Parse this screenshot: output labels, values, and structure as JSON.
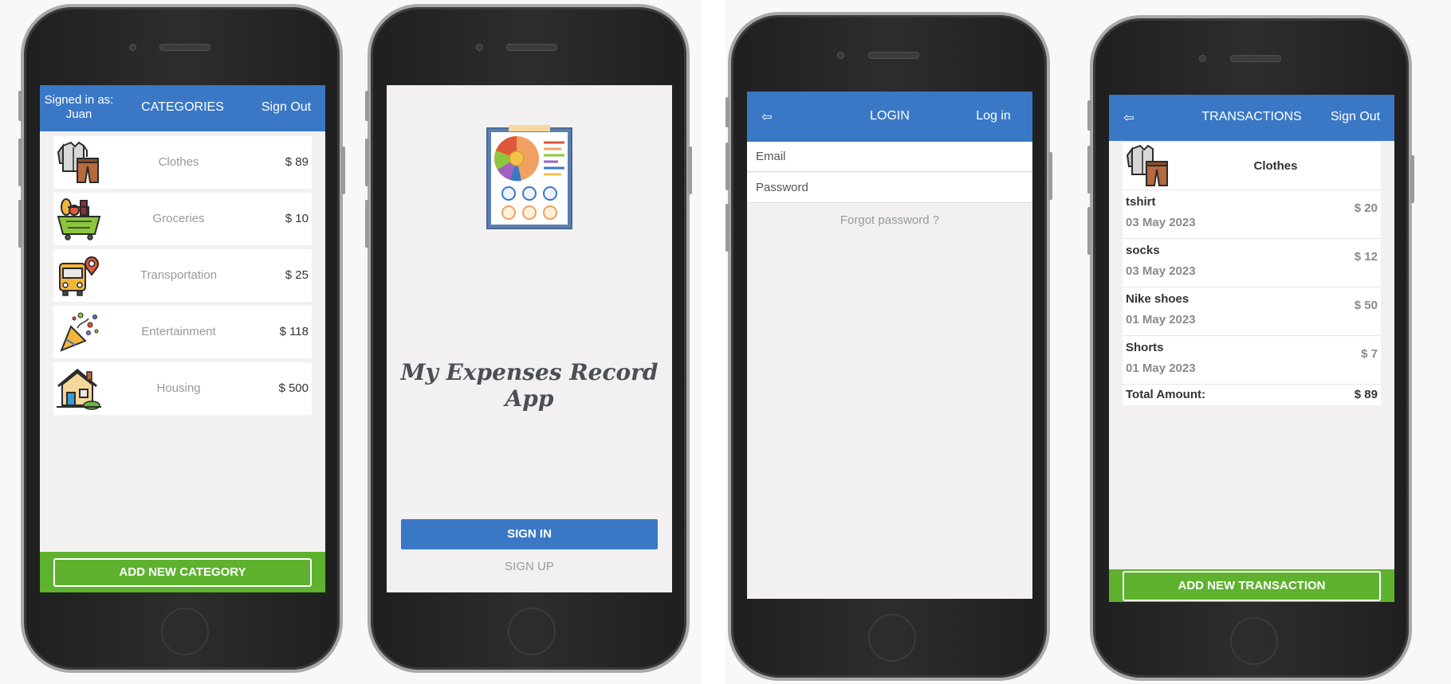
{
  "categories_screen": {
    "header": {
      "signed_in": "Signed in as: Juan",
      "title": "CATEGORIES",
      "sign_out": "Sign Out"
    },
    "items": [
      {
        "name": "Clothes",
        "amount": "$ 89",
        "icon": "clothes-icon"
      },
      {
        "name": "Groceries",
        "amount": "$ 10",
        "icon": "groceries-icon"
      },
      {
        "name": "Transportation",
        "amount": "$ 25",
        "icon": "bus-icon"
      },
      {
        "name": "Entertainment",
        "amount": "$ 118",
        "icon": "party-popper-icon"
      },
      {
        "name": "Housing",
        "amount": "$ 500",
        "icon": "house-icon"
      }
    ],
    "add_button": "ADD NEW CATEGORY"
  },
  "splash_screen": {
    "app_title": "My Expenses Record App",
    "logo_icon": "expense-report-icon",
    "sign_in": "SIGN IN",
    "sign_up": "SIGN UP"
  },
  "login_screen": {
    "header": {
      "back": "⇦",
      "title": "LOGIN",
      "action": "Log in"
    },
    "email_placeholder": "Email",
    "password_placeholder": "Password",
    "forgot": "Forgot password ?"
  },
  "transactions_screen": {
    "header": {
      "back": "⇦",
      "title": "TRANSACTIONS",
      "sign_out": "Sign Out"
    },
    "category": "Clothes",
    "items": [
      {
        "name": "tshirt",
        "date": "03 May 2023",
        "amount": "$ 20"
      },
      {
        "name": "socks",
        "date": "03 May 2023",
        "amount": "$ 12"
      },
      {
        "name": "Nike shoes",
        "date": "01 May 2023",
        "amount": "$ 50"
      },
      {
        "name": "Shorts",
        "date": "01 May 2023",
        "amount": "$ 7"
      }
    ],
    "total_label": "Total Amount:",
    "total_value": "$ 89",
    "add_button": "ADD NEW TRANSACTION"
  },
  "colors": {
    "header_blue": "#3a78c6",
    "accent_green": "#5eb22e",
    "screen_bg": "#f2f0f0",
    "phone_body": "#262626"
  }
}
